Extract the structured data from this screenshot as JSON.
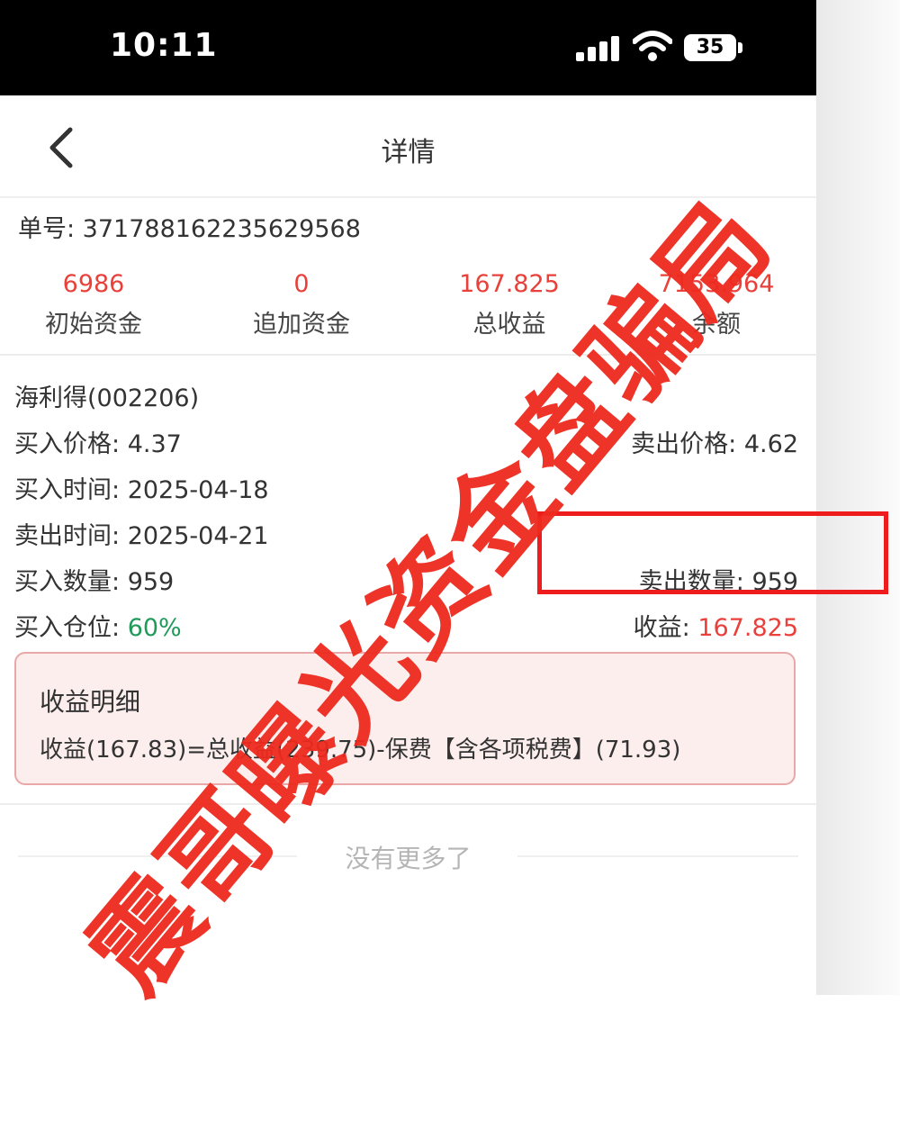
{
  "status_bar": {
    "time": "10:11",
    "battery": "35"
  },
  "nav": {
    "title": "详情"
  },
  "order": {
    "label": "单号: 371788162235629568"
  },
  "stats": [
    {
      "value": "6986",
      "label": "初始资金"
    },
    {
      "value": "0",
      "label": "追加资金"
    },
    {
      "value": "167.825",
      "label": "总收益"
    },
    {
      "value": "7153.964",
      "label": "余额"
    }
  ],
  "trade": {
    "stock": "海利得(002206)",
    "buy_price_label": "买入价格:",
    "buy_price": "4.37",
    "sell_price_label": "卖出价格:",
    "sell_price": "4.62",
    "buy_time_label": "买入时间:",
    "buy_time": "2025-04-18",
    "sell_time_label": "卖出时间:",
    "sell_time": "2025-04-21",
    "buy_qty_label": "买入数量:",
    "buy_qty": "959",
    "sell_qty_label": "卖出数量:",
    "sell_qty": "959",
    "position_label": "买入仓位:",
    "position": "60%",
    "profit_label": "收益:",
    "profit": "167.825"
  },
  "detail": {
    "title": "收益明细",
    "text": "收益(167.83)=总收益(239.75)-保费【含各项税费】(71.93)"
  },
  "footer": {
    "no_more": "没有更多了"
  },
  "watermark": {
    "text": "震哥曝光资金盘骗局"
  },
  "colors": {
    "accent_red": "#e8413b",
    "green": "#1f9a5a",
    "highlight": "#ee1c1c"
  }
}
